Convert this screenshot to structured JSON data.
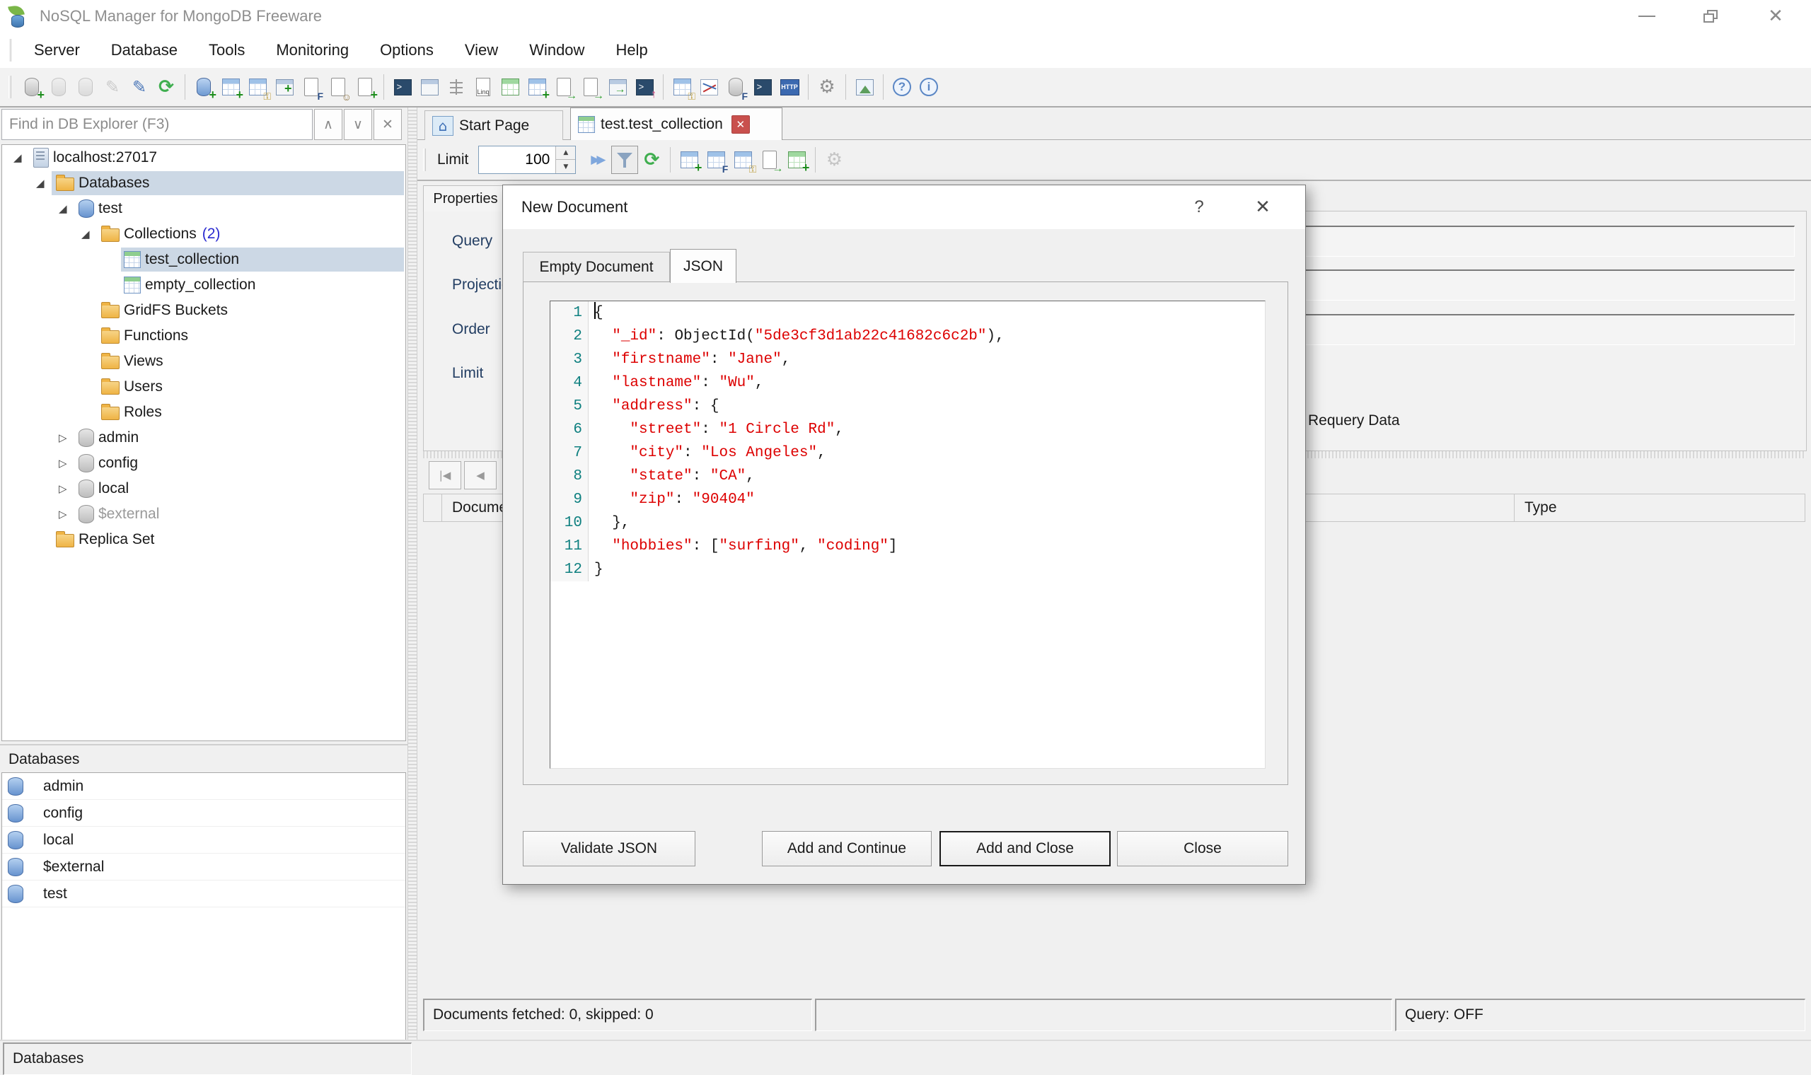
{
  "window": {
    "title": "NoSQL Manager for MongoDB Freeware"
  },
  "menu": {
    "items": [
      "Server",
      "Database",
      "Tools",
      "Monitoring",
      "Options",
      "View",
      "Window",
      "Help"
    ]
  },
  "icons": {
    "expanded": "◢",
    "collapsed": "▷",
    "close_x": "✕",
    "up": "∧",
    "down": "∨",
    "home": "⌂",
    "spin_up": "▲",
    "spin_down": "▼",
    "ffwd": "▶▶",
    "refresh": "⟳",
    "pencil": "✎",
    "gear": "⚙",
    "help": "?",
    "info": "i",
    "nav_first": "|◀",
    "nav_prev": "◀"
  },
  "explorer": {
    "find_placeholder": "Find in DB Explorer (F3)",
    "tree": [
      {
        "label": "localhost:27017"
      },
      {
        "label": "Databases"
      },
      {
        "label": "test"
      },
      {
        "label": "Collections",
        "count": "(2)"
      },
      {
        "label": "test_collection"
      },
      {
        "label": "empty_collection"
      },
      {
        "label": "GridFS Buckets"
      },
      {
        "label": "Functions"
      },
      {
        "label": "Views"
      },
      {
        "label": "Users"
      },
      {
        "label": "Roles"
      },
      {
        "label": "admin"
      },
      {
        "label": "config"
      },
      {
        "label": "local"
      },
      {
        "label": "$external"
      },
      {
        "label": "Replica Set"
      }
    ],
    "databases_panel": {
      "title": "Databases",
      "items": [
        "admin",
        "config",
        "local",
        "$external",
        "test"
      ]
    }
  },
  "main": {
    "tabs": [
      {
        "label": "Start Page"
      },
      {
        "label": "test.test_collection"
      }
    ],
    "toolbar": {
      "limit_label": "Limit",
      "limit_value": "100"
    },
    "properties": {
      "tab": "Properties",
      "rows": [
        "Query",
        "Projection",
        "Order",
        "Limit"
      ],
      "requery_label": "Requery Data"
    },
    "table": {
      "columns": [
        "Documents",
        "Type"
      ]
    },
    "statusbar": {
      "fetched": "Documents fetched: 0, skipped: 0",
      "query": "Query: OFF"
    }
  },
  "app_statusbar": {
    "text": "Databases"
  },
  "dialog": {
    "title": "New Document",
    "tabs": [
      {
        "label": "Empty Document"
      },
      {
        "label": "JSON"
      }
    ],
    "buttons": [
      "Validate JSON",
      "Add and Continue",
      "Add and Close",
      "Close"
    ],
    "editor": {
      "lines": [
        {
          "n": "1",
          "parts": [
            {
              "t": "{",
              "r": false
            }
          ]
        },
        {
          "n": "2",
          "parts": [
            {
              "t": "  ",
              "r": false
            },
            {
              "t": "\"_id\"",
              "r": true
            },
            {
              "t": ": ObjectId(",
              "r": false
            },
            {
              "t": "\"5de3cf3d1ab22c41682c6c2b\"",
              "r": true
            },
            {
              "t": "),",
              "r": false
            }
          ]
        },
        {
          "n": "3",
          "parts": [
            {
              "t": "  ",
              "r": false
            },
            {
              "t": "\"firstname\"",
              "r": true
            },
            {
              "t": ": ",
              "r": false
            },
            {
              "t": "\"Jane\"",
              "r": true
            },
            {
              "t": ",",
              "r": false
            }
          ]
        },
        {
          "n": "4",
          "parts": [
            {
              "t": "  ",
              "r": false
            },
            {
              "t": "\"lastname\"",
              "r": true
            },
            {
              "t": ": ",
              "r": false
            },
            {
              "t": "\"Wu\"",
              "r": true
            },
            {
              "t": ",",
              "r": false
            }
          ]
        },
        {
          "n": "5",
          "parts": [
            {
              "t": "  ",
              "r": false
            },
            {
              "t": "\"address\"",
              "r": true
            },
            {
              "t": ": {",
              "r": false
            }
          ]
        },
        {
          "n": "6",
          "parts": [
            {
              "t": "    ",
              "r": false
            },
            {
              "t": "\"street\"",
              "r": true
            },
            {
              "t": ": ",
              "r": false
            },
            {
              "t": "\"1 Circle Rd\"",
              "r": true
            },
            {
              "t": ",",
              "r": false
            }
          ]
        },
        {
          "n": "7",
          "parts": [
            {
              "t": "    ",
              "r": false
            },
            {
              "t": "\"city\"",
              "r": true
            },
            {
              "t": ": ",
              "r": false
            },
            {
              "t": "\"Los Angeles\"",
              "r": true
            },
            {
              "t": ",",
              "r": false
            }
          ]
        },
        {
          "n": "8",
          "parts": [
            {
              "t": "    ",
              "r": false
            },
            {
              "t": "\"state\"",
              "r": true
            },
            {
              "t": ": ",
              "r": false
            },
            {
              "t": "\"CA\"",
              "r": true
            },
            {
              "t": ",",
              "r": false
            }
          ]
        },
        {
          "n": "9",
          "parts": [
            {
              "t": "    ",
              "r": false
            },
            {
              "t": "\"zip\"",
              "r": true
            },
            {
              "t": ": ",
              "r": false
            },
            {
              "t": "\"90404\"",
              "r": true
            }
          ]
        },
        {
          "n": "10",
          "parts": [
            {
              "t": "  },",
              "r": false
            }
          ]
        },
        {
          "n": "11",
          "parts": [
            {
              "t": "  ",
              "r": false
            },
            {
              "t": "\"hobbies\"",
              "r": true
            },
            {
              "t": ": [",
              "r": false
            },
            {
              "t": "\"surfing\"",
              "r": true
            },
            {
              "t": ", ",
              "r": false
            },
            {
              "t": "\"coding\"",
              "r": true
            },
            {
              "t": "]",
              "r": false
            }
          ]
        },
        {
          "n": "12",
          "parts": [
            {
              "t": "}",
              "r": false
            }
          ]
        }
      ]
    }
  },
  "colors": {
    "string_red": "#dd0000",
    "line_number_teal": "#0f8080",
    "selection": "#ccd8e5",
    "tab_close_red": "#c9504d"
  }
}
